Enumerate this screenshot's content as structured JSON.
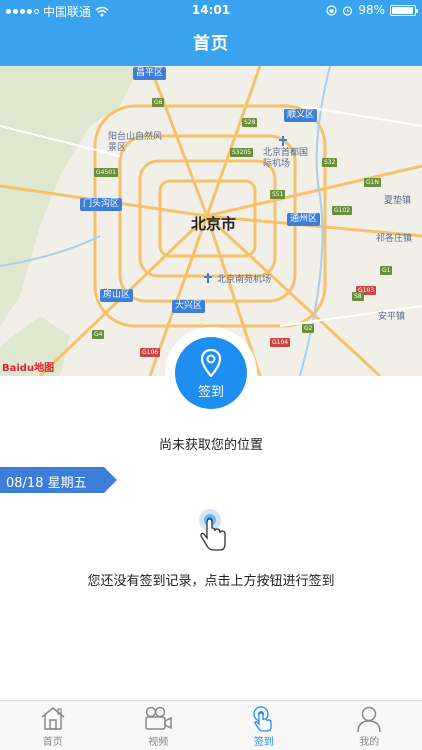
{
  "status_bar": {
    "carrier": "中国联通",
    "time": "14:01",
    "battery": "98%"
  },
  "nav": {
    "title": "首页"
  },
  "map": {
    "city": "北京市",
    "district_labels": [
      "昌平区",
      "顺义区",
      "门头沟区",
      "通州区",
      "房山区",
      "大兴区"
    ],
    "place_labels": [
      "阳台山自然风景区",
      "北京首都国际机场",
      "北京南苑机场",
      "夏垫镇",
      "祁各庄镇",
      "安平镇"
    ],
    "road_labels": [
      "G6",
      "S28",
      "S32",
      "G4501",
      "S3205",
      "G1N",
      "G102",
      "S51",
      "G1",
      "G103",
      "S8",
      "G4",
      "G2",
      "G104",
      "G106"
    ],
    "logo_text": "Baidu地图"
  },
  "checkin": {
    "button_label": "签到",
    "location_status": "尚未获取您的位置"
  },
  "date_tag": {
    "text": "08/18 星期五"
  },
  "empty_state": {
    "text": "您还没有签到记录，点击上方按钮进行签到"
  },
  "tabs": [
    {
      "label": "首页",
      "icon": "home-icon",
      "active": false
    },
    {
      "label": "视频",
      "icon": "video-icon",
      "active": false
    },
    {
      "label": "签到",
      "icon": "checkin-hand-icon",
      "active": true
    },
    {
      "label": "我的",
      "icon": "profile-icon",
      "active": false
    }
  ],
  "colors": {
    "primary": "#3aa3f0",
    "button": "#1e8ef0",
    "tag_blue": "#3d7fd8"
  }
}
